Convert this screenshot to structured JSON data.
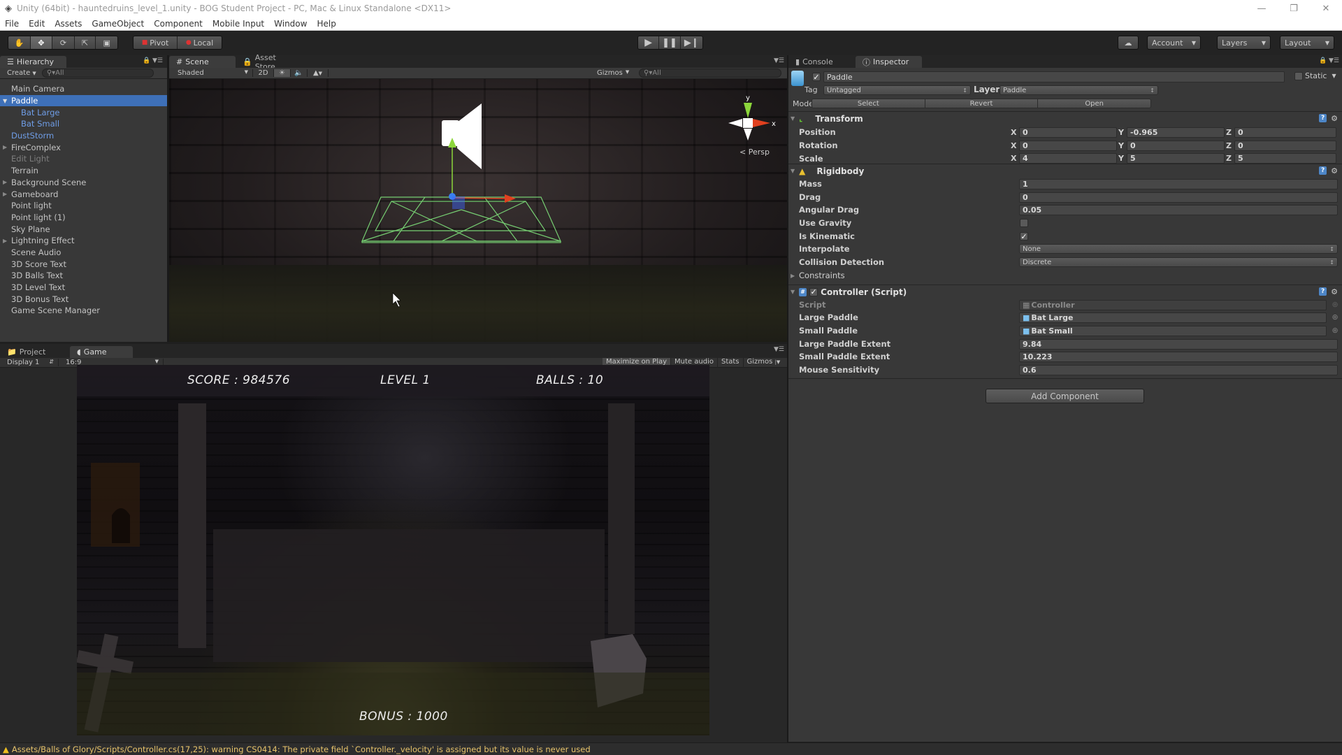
{
  "window": {
    "title": "Unity (64bit) - hauntedruins_level_1.unity - BOG Student Project - PC, Mac & Linux Standalone <DX11>",
    "controls": [
      "minimize",
      "restore",
      "close"
    ]
  },
  "menu": [
    "File",
    "Edit",
    "Assets",
    "GameObject",
    "Component",
    "Mobile Input",
    "Window",
    "Help"
  ],
  "toolbar": {
    "transform_tools": [
      "hand-tool",
      "move-tool",
      "rotate-tool",
      "scale-tool",
      "rect-tool"
    ],
    "active_tool": "move-tool",
    "pivot_label": "Pivot",
    "local_label": "Local",
    "play_controls": [
      "play",
      "pause",
      "step"
    ],
    "account_label": "Account",
    "layers_label": "Layers",
    "layout_label": "Layout"
  },
  "hierarchy": {
    "tab_label": "Hierarchy",
    "create_label": "Create",
    "search_placeholder": "All",
    "items": [
      {
        "label": "Main Camera",
        "expandable": false,
        "state": "normal"
      },
      {
        "label": "Paddle",
        "expandable": true,
        "expanded": true,
        "state": "selected"
      },
      {
        "label": "Bat Large",
        "expandable": false,
        "state": "prefab-child"
      },
      {
        "label": "Bat Small",
        "expandable": false,
        "state": "prefab-child"
      },
      {
        "label": "DustStorm",
        "expandable": false,
        "state": "prefab"
      },
      {
        "label": "FireComplex",
        "expandable": true,
        "state": "normal"
      },
      {
        "label": "Edit Light",
        "expandable": false,
        "state": "disabled"
      },
      {
        "label": "Terrain",
        "expandable": false,
        "state": "normal"
      },
      {
        "label": "Background Scene",
        "expandable": true,
        "state": "normal"
      },
      {
        "label": "Gameboard",
        "expandable": true,
        "state": "normal"
      },
      {
        "label": "Point light",
        "expandable": false,
        "state": "normal"
      },
      {
        "label": "Point light (1)",
        "expandable": false,
        "state": "normal"
      },
      {
        "label": "Sky Plane",
        "expandable": false,
        "state": "normal"
      },
      {
        "label": "Lightning Effect",
        "expandable": true,
        "state": "normal"
      },
      {
        "label": "Scene Audio",
        "expandable": false,
        "state": "normal"
      },
      {
        "label": "3D Score Text",
        "expandable": false,
        "state": "normal"
      },
      {
        "label": "3D Balls Text",
        "expandable": false,
        "state": "normal"
      },
      {
        "label": "3D Level Text",
        "expandable": false,
        "state": "normal"
      },
      {
        "label": "3D Bonus Text",
        "expandable": false,
        "state": "normal"
      },
      {
        "label": "Game Scene Manager",
        "expandable": false,
        "state": "normal"
      }
    ]
  },
  "scene": {
    "tabs": [
      {
        "label": "Scene",
        "active": true
      },
      {
        "label": "Asset Store",
        "active": false
      }
    ],
    "shading_mode": "Shaded",
    "mode_2d_label": "2D",
    "gizmos_label": "Gizmos",
    "search_placeholder": "All",
    "gizmo_axes": {
      "y": "y",
      "x": "x"
    },
    "projection_label": "Persp"
  },
  "game": {
    "tabs": [
      {
        "label": "Project",
        "active": false
      },
      {
        "label": "Game",
        "active": true
      }
    ],
    "display_label": "Display 1",
    "aspect_label": "16:9",
    "maximize_label": "Maximize on Play",
    "mute_label": "Mute audio",
    "stats_label": "Stats",
    "gizmos_label": "Gizmos",
    "hud": {
      "score": "SCORE : 984576",
      "level": "LEVEL 1",
      "balls": "BALLS : 10",
      "bonus": "BONUS : 1000"
    }
  },
  "inspector": {
    "tabs": [
      {
        "label": "Console",
        "active": false
      },
      {
        "label": "Inspector",
        "active": true
      }
    ],
    "object_name": "Paddle",
    "active": true,
    "static_label": "Static",
    "static": false,
    "tag_label": "Tag",
    "tag_value": "Untagged",
    "layer_label": "Layer",
    "layer_value": "Paddle",
    "model_label": "Model",
    "model_buttons": [
      "Select",
      "Revert",
      "Open"
    ],
    "transform": {
      "title": "Transform",
      "rows": [
        {
          "label": "Position",
          "x": "0",
          "y": "-0.965",
          "z": "0"
        },
        {
          "label": "Rotation",
          "x": "0",
          "y": "0",
          "z": "0"
        },
        {
          "label": "Scale",
          "x": "4",
          "y": "5",
          "z": "5"
        }
      ]
    },
    "rigidbody": {
      "title": "Rigidbody",
      "mass_label": "Mass",
      "mass": "1",
      "drag_label": "Drag",
      "drag": "0",
      "angular_drag_label": "Angular Drag",
      "angular_drag": "0.05",
      "use_gravity_label": "Use Gravity",
      "use_gravity": false,
      "is_kinematic_label": "Is Kinematic",
      "is_kinematic": true,
      "interpolate_label": "Interpolate",
      "interpolate": "None",
      "collision_label": "Collision Detection",
      "collision": "Discrete",
      "constraints_label": "Constraints"
    },
    "controller": {
      "title": "Controller (Script)",
      "enabled": true,
      "script_label": "Script",
      "script": "Controller",
      "large_paddle_label": "Large Paddle",
      "large_paddle": "Bat Large",
      "small_paddle_label": "Small Paddle",
      "small_paddle": "Bat Small",
      "large_extent_label": "Large Paddle Extent",
      "large_extent": "9.84",
      "small_extent_label": "Small Paddle Extent",
      "small_extent": "10.223",
      "sensitivity_label": "Mouse Sensitivity",
      "sensitivity": "0.6"
    },
    "add_component_label": "Add Component"
  },
  "status": {
    "icon": "warning-icon",
    "message": "Assets/Balls of Glory/Scripts/Controller.cs(17,25): warning CS0414: The private field `Controller._velocity' is assigned but its value is never used"
  },
  "colors": {
    "selection": "#3e70b8",
    "prefab_text": "#6f9de6",
    "warning": "#e8c46b",
    "gizmo_y": "#8cd63b",
    "gizmo_x": "#e0401f",
    "wireframe": "#7ee07a"
  }
}
